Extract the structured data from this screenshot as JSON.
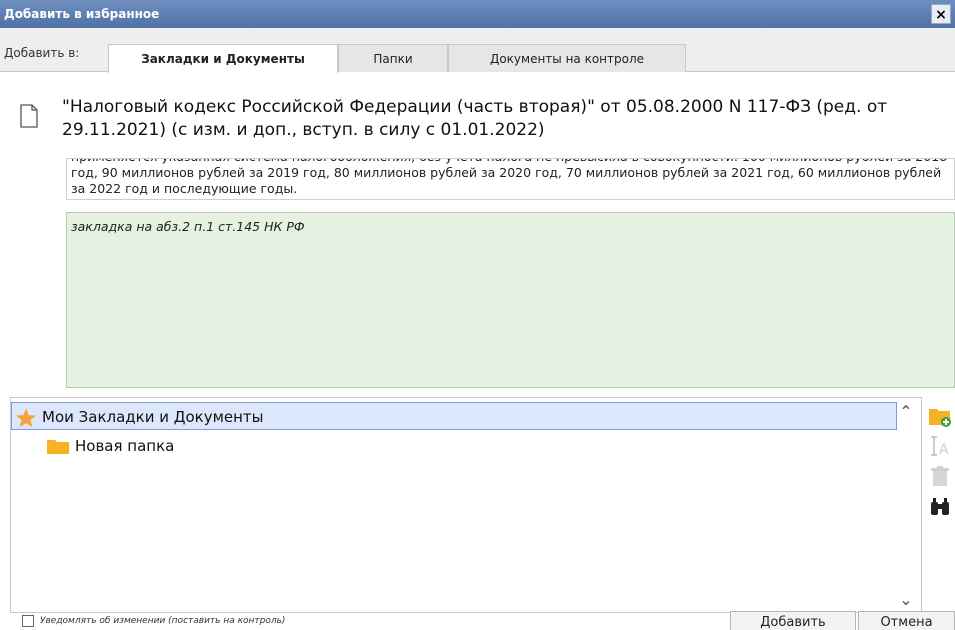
{
  "window": {
    "title": "Добавить в избранное",
    "close_glyph": "×"
  },
  "tabs": {
    "prefix": "Добавить в:",
    "items": [
      {
        "label": "Закладки и Документы",
        "active": true
      },
      {
        "label": "Папки",
        "active": false
      },
      {
        "label": "Документы на контроле",
        "active": false
      }
    ]
  },
  "document": {
    "icon": "document-icon",
    "title": "\"Налоговый кодекс Российской Федерации (часть вторая)\" от 05.08.2000 N 117-ФЗ (ред. от 29.11.2021) (с изм. и доп., вступ. в силу с 01.01.2022)"
  },
  "excerpt": {
    "text": "применяется указанная система налогообложения, без учета налога не превысила в совокупности: 100 миллионов рублей за 2018 год, 90 миллионов рублей за 2019 год, 80 миллионов рублей за 2020 год, 70 миллионов рублей за 2021 год, 60 миллионов рублей за 2022 год и последующие годы."
  },
  "comment": {
    "value": "закладка на абз.2 п.1 ст.145 НК РФ"
  },
  "tree": {
    "root": {
      "label": "Мои Закладки и Документы",
      "icon": "star-icon"
    },
    "children": [
      {
        "label": "Новая папка",
        "icon": "folder-icon"
      }
    ]
  },
  "side_tools": [
    "new-folder-icon",
    "rename-icon",
    "delete-icon",
    "find-icon"
  ],
  "footer": {
    "notify_label": "Уведомлять об изменении (поставить на контроль)",
    "notify_checked": false,
    "add_label": "Добавить",
    "cancel_label": "Отмена"
  },
  "colors": {
    "titlebar": "#4f71a6",
    "comment_bg": "#e5f2e2",
    "selection_bg": "#dde7fb",
    "star": "#f2a33a",
    "folder": "#f5b227"
  }
}
